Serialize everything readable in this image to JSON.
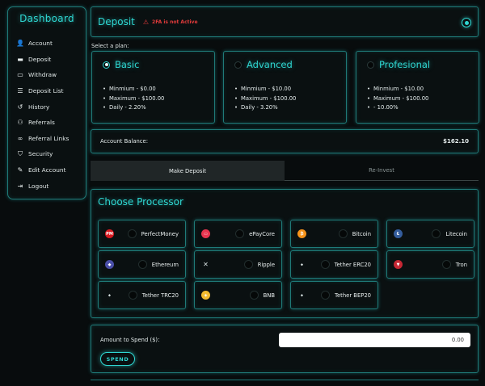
{
  "sidebar": {
    "title": "Dashboard",
    "items": [
      {
        "label": "Account",
        "icon": "user-icon"
      },
      {
        "label": "Deposit",
        "icon": "wallet-icon"
      },
      {
        "label": "Withdraw",
        "icon": "withdraw-icon"
      },
      {
        "label": "Deposit List",
        "icon": "list-icon"
      },
      {
        "label": "History",
        "icon": "history-icon"
      },
      {
        "label": "Referrals",
        "icon": "users-icon"
      },
      {
        "label": "Referral Links",
        "icon": "link-icon"
      },
      {
        "label": "Security",
        "icon": "shield-icon"
      },
      {
        "label": "Edit Account",
        "icon": "edit-icon"
      },
      {
        "label": "Logout",
        "icon": "logout-icon"
      }
    ]
  },
  "deposit": {
    "title": "Deposit",
    "warning": "2FA is not Active",
    "select_label": "Select a plan:"
  },
  "plans": [
    {
      "name": "Basic",
      "selected": true,
      "details": [
        "Minmium - $0.00",
        "Maximum - $100.00",
        "Daily - 2.20%"
      ]
    },
    {
      "name": "Advanced",
      "selected": false,
      "details": [
        "Minmium - $10.00",
        "Maximum - $100.00",
        "Daily - 3.20%"
      ]
    },
    {
      "name": "Profesional",
      "selected": false,
      "details": [
        "Minmium - $10.00",
        "Maximum - $100.00",
        "- 10.00%"
      ]
    }
  ],
  "balance": {
    "label": "Account Balance:",
    "value": "$162.10"
  },
  "tabs": [
    {
      "label": "Make Deposit",
      "active": true
    },
    {
      "label": "Re-Invest",
      "active": false
    }
  ],
  "processor": {
    "title": "Choose Processor",
    "items": [
      {
        "name": "PerfectMoney",
        "icon": "perfectmoney-icon",
        "color": "#d71920",
        "glyph": "PM"
      },
      {
        "name": "ePayCore",
        "icon": "epaycore-icon",
        "color": "#e8344e",
        "glyph": "▭"
      },
      {
        "name": "Bitcoin",
        "icon": "bitcoin-icon",
        "color": "#f7931a",
        "glyph": "₿"
      },
      {
        "name": "Litecoin",
        "icon": "litecoin-icon",
        "color": "#345d9d",
        "glyph": "Ł"
      },
      {
        "name": "Ethereum",
        "icon": "ethereum-icon",
        "color": "#4a4fa8",
        "glyph": "◆"
      },
      {
        "name": "Ripple",
        "icon": "ripple-icon",
        "color": "transparent",
        "glyph": "✕"
      },
      {
        "name": "Tether ERC20",
        "icon": "tether-erc20-icon",
        "color": "transparent",
        "glyph": "⬩"
      },
      {
        "name": "Tron",
        "icon": "tron-icon",
        "color": "#c62734",
        "glyph": "▼"
      },
      {
        "name": "Tether TRC20",
        "icon": "tether-trc20-icon",
        "color": "transparent",
        "glyph": "⬩"
      },
      {
        "name": "BNB",
        "icon": "bnb-icon",
        "color": "#f3ba2f",
        "glyph": "◈"
      },
      {
        "name": "Tether BEP20",
        "icon": "tether-bep20-icon",
        "color": "transparent",
        "glyph": "⬩"
      }
    ]
  },
  "spend": {
    "label": "Amount to Spend ($):",
    "value": "0.00",
    "button": "SPEND"
  },
  "colors": {
    "accent": "#2fd7d2",
    "warning": "#e23b3b",
    "background": "#080c0d"
  }
}
